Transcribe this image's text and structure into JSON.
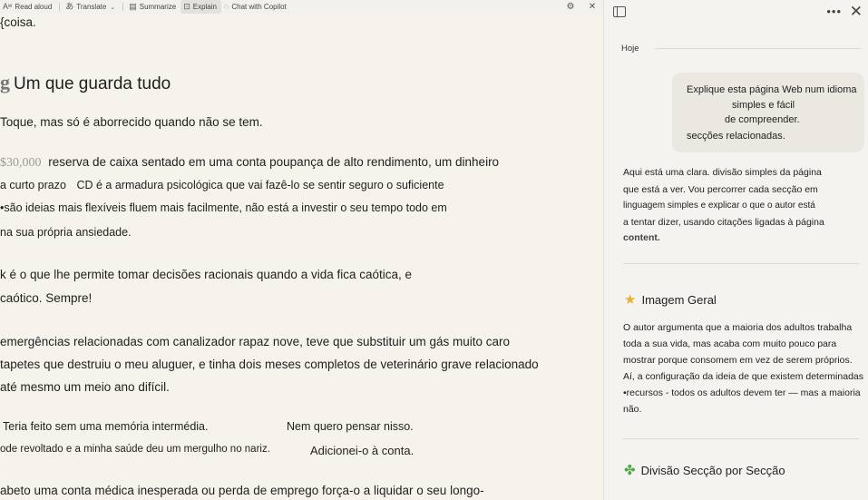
{
  "toolbar": {
    "read_aloud": "Read aloud",
    "translate": "Translate",
    "summarize": "Summarize",
    "explain": "Explain",
    "chat": "Chat with Copilot"
  },
  "article": {
    "lines": {
      "l0": "{coisa.",
      "heading_glyph": "g",
      "heading": "Um que guarda tudo",
      "l1": "Toque, mas só é aborrecido quando não se tem.",
      "amount": "$30,000",
      "l2": "reserva de caixa sentado em uma conta poupança de alto rendimento, um dinheiro",
      "l3a": "a curto prazo",
      "l3b": "CD é a armadura psicológica que vai fazê-lo se sentir seguro o suficiente",
      "l4": "•são ideias mais flexíveis fluem mais facilmente, não está a investir o seu tempo todo em",
      "l5": "na sua própria ansiedade.",
      "l6": "k é o que lhe permite tomar decisões racionais quando a vida fica caótica, e",
      "l7": "caótico. Sempre!",
      "l8": "emergências relacionadas com canalizador rapaz nove, teve que substituir um gás muito caro",
      "l9": "tapetes que destruiu o meu aluguer, e tinha dois meses completos de veterinário grave relacionado",
      "l10": "até mesmo um meio ano difícil.",
      "l11a": "Teria feito sem uma memória intermédia.",
      "l11b": "Nem quero pensar nisso.",
      "l12a": "ode revoltado e a minha saúde deu um mergulho no nariz.",
      "l12b": "Adicionei-o à conta.",
      "l13": "abeto uma conta médica inesperada ou perda de emprego força-o a liquidar o seu longo-"
    }
  },
  "panel": {
    "date": "Hoje",
    "user_message": {
      "line1": "Explique esta página Web num idioma",
      "line2": "simples e fácil",
      "line3": "de compreender.",
      "line4": "secções relacionadas."
    },
    "response": {
      "r1": "Aqui está uma clara. divisão simples da página",
      "r2": "que está a ver. Vou percorrer cada secção em",
      "r3": "linguagem simples e explicar o que o autor está",
      "r4": "a tentar dizer, usando citações ligadas à página",
      "r5": "content."
    },
    "section1": {
      "title": "Imagem Geral",
      "p1": "O autor argumenta que a maioria dos adultos trabalha",
      "p2": "toda a sua vida, mas acaba com muito pouco para",
      "p3": "mostrar porque consomem em vez de serem próprios.",
      "p4": "Aí, a configuração da ideia de que existem determinadas",
      "p5": "•recursos - todos os adultos devem ter — mas a maioria",
      "p6": "não."
    },
    "section2": {
      "title": "Divisão Secção por Secção"
    }
  }
}
